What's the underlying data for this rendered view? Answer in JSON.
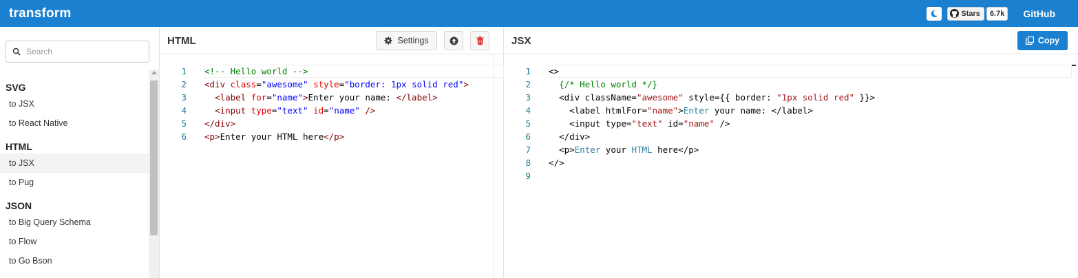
{
  "app": {
    "title": "transform"
  },
  "topbar": {
    "stars_label": "Stars",
    "stars_count": "6.7k",
    "github_label": "GitHub"
  },
  "sidebar": {
    "search_placeholder": "Search",
    "groups": [
      {
        "title": "SVG",
        "items": [
          "to JSX",
          "to React Native"
        ]
      },
      {
        "title": "HTML",
        "items": [
          "to JSX",
          "to Pug"
        ]
      },
      {
        "title": "JSON",
        "items": [
          "to Big Query Schema",
          "to Flow",
          "to Go Bson"
        ]
      }
    ]
  },
  "html_panel": {
    "title": "HTML",
    "settings_label": "Settings",
    "line_numbers": [
      "1",
      "2",
      "3",
      "4",
      "5",
      "6"
    ]
  },
  "jsx_panel": {
    "title": "JSX",
    "copy_label": "Copy",
    "line_numbers": [
      "1",
      "2",
      "3",
      "4",
      "5",
      "6",
      "7",
      "8",
      "9"
    ]
  }
}
